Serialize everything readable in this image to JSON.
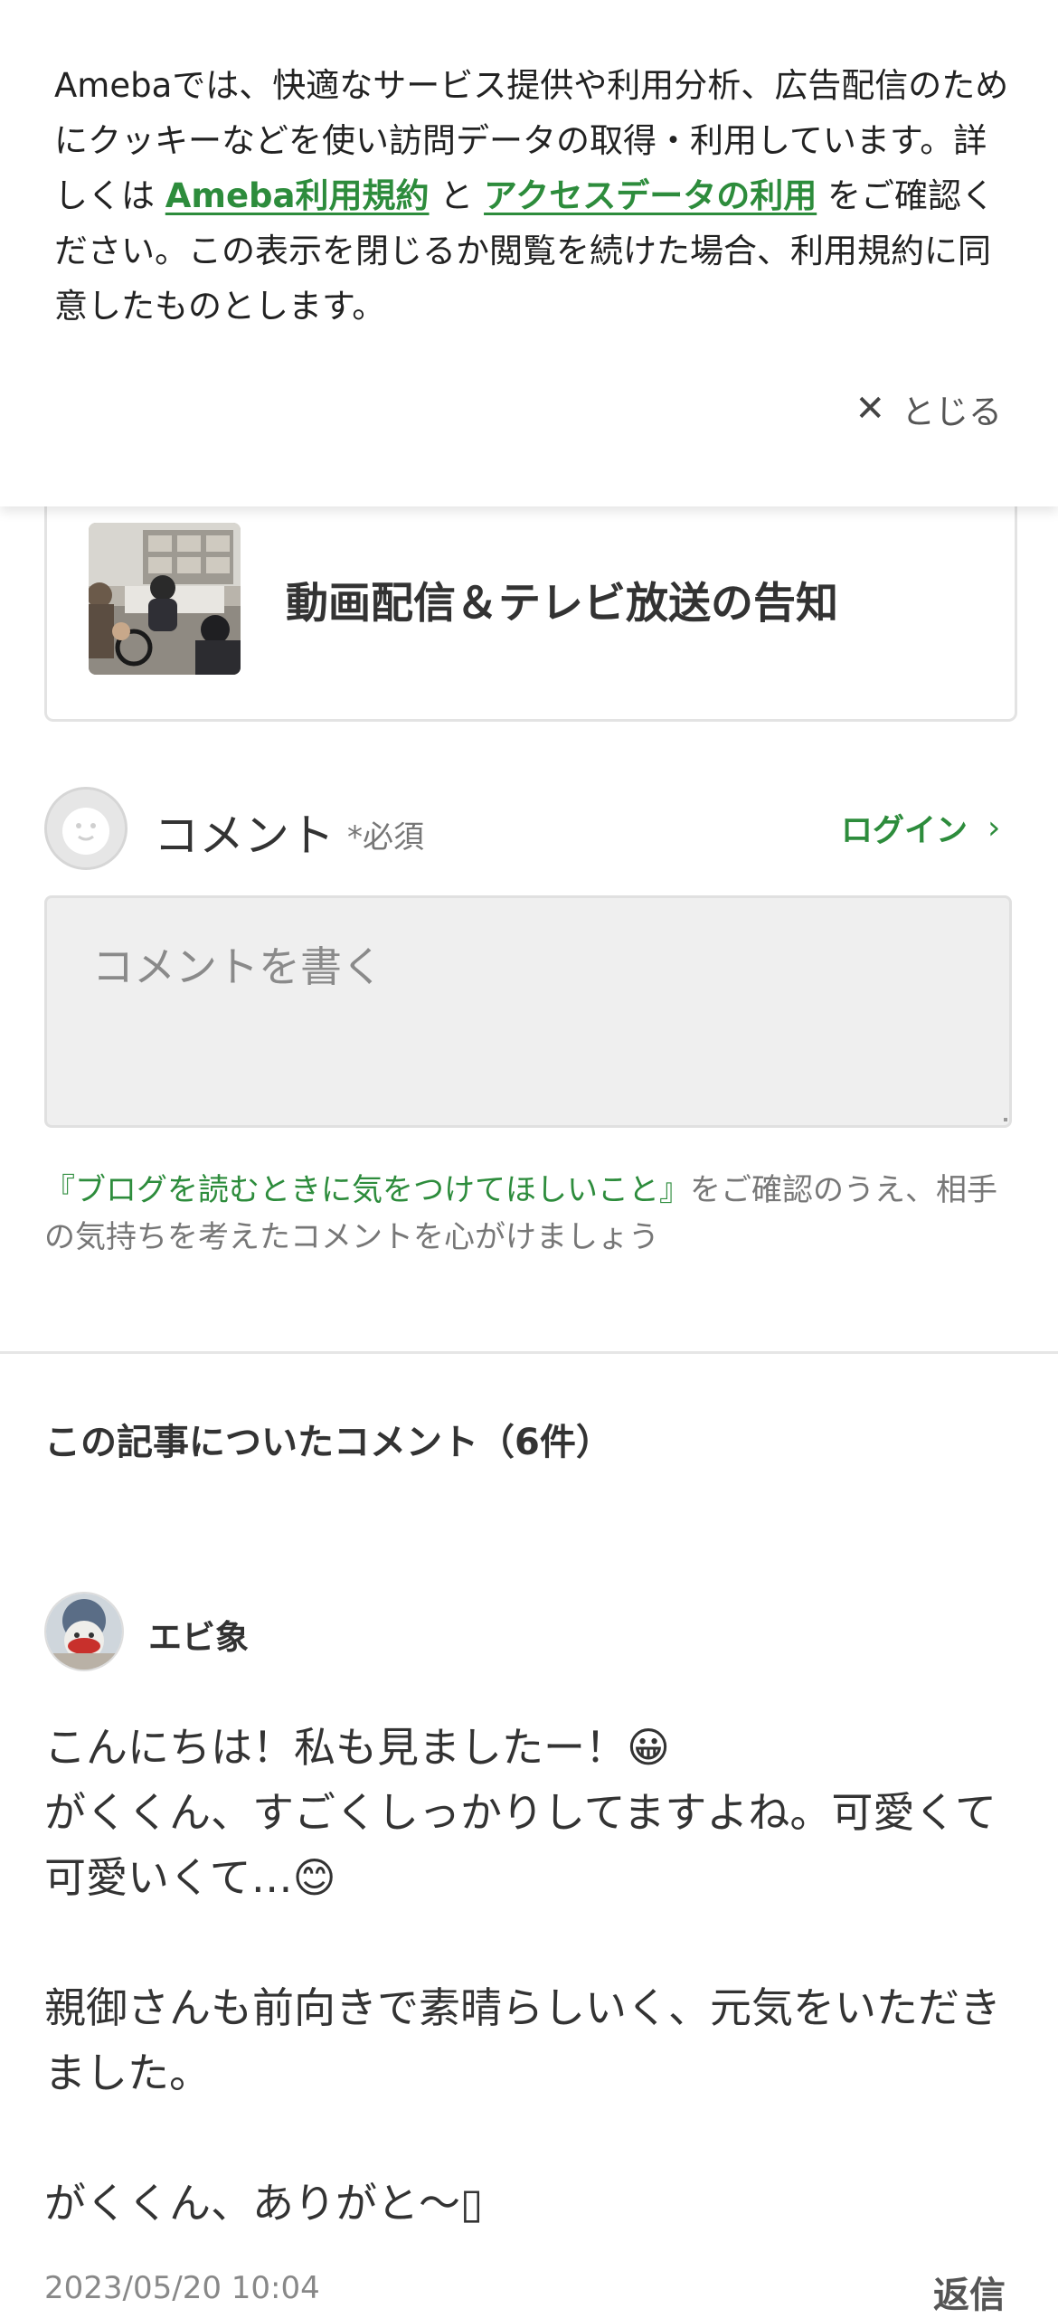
{
  "cookie_banner": {
    "text_part1": "Amebaでは、快適なサービス提供や利用分析、広告配信のためにクッキーなどを使い訪問データの取得・利用しています。詳しくは ",
    "link_terms": "Ameba利用規約",
    "text_part2": " と ",
    "link_access": "アクセスデータの利用",
    "text_part3": " をご確認ください。この表示を閉じるか閲覧を続けた場合、利用規約に同意したものとします。",
    "close_label": "とじる",
    "close_icon": "close-icon"
  },
  "related": {
    "title": "動画配信＆テレビ放送の告知"
  },
  "comment_form": {
    "heading": "コメント",
    "required": "*必須",
    "login_label": "ログイン",
    "login_icon": "chevron-right-icon",
    "placeholder": "コメントを書く",
    "guideline_link": "『ブログを読むときに気をつけてほしいこと』",
    "guideline_rest": "をご確認のうえ、相手の気持ちを考えたコメントを心がけましょう"
  },
  "comments": {
    "heading": "この記事についたコメント（6件）",
    "items": [
      {
        "author": "エビ象",
        "lines": [
          "こんにちは！私も見ましたー！😀",
          "がくくん、すごくしっかりしてますよね。可愛くて可愛いくて…😊",
          "",
          "親御さんも前向きで素晴らしいく、元気をいただきました。",
          "",
          "がくくん、ありがと〜▯"
        ],
        "date": "2023/05/20 10:04",
        "reply_label": "返信"
      }
    ]
  },
  "colors": {
    "accent_green": "#2d8c3c",
    "text_main": "#333333",
    "text_muted": "#777777"
  }
}
